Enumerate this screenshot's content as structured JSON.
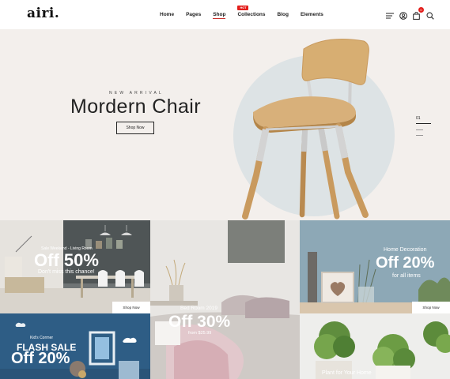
{
  "header": {
    "logo": "airi.",
    "nav": [
      {
        "label": "Home"
      },
      {
        "label": "Pages"
      },
      {
        "label": "Shop"
      },
      {
        "label": "Collections",
        "badge": "HOT"
      },
      {
        "label": "Blog"
      },
      {
        "label": "Elements"
      }
    ],
    "active_nav": "Shop",
    "cart_count": "0",
    "icons": [
      "menu-icon",
      "account-icon",
      "cart-icon",
      "search-icon"
    ]
  },
  "hero": {
    "kicker": "NEW ARRIVAL",
    "title": "Mordern Chair",
    "button": "Shop Now",
    "slide_number": "01"
  },
  "promos": {
    "living": {
      "kicker": "Sale Weekend - Living Room",
      "headline": "Off 50%",
      "subtext": "Don't miss this chance!",
      "button": "Shop Now"
    },
    "bedroom": {
      "kicker": "Bed Room 2019",
      "headline": "Off 30%",
      "subtext": "from $25.99"
    },
    "decoration": {
      "kicker": "Home Decoration",
      "headline": "Off 20%",
      "subtext": "for all items",
      "button": "Shop Now"
    },
    "kids": {
      "kicker": "Kid's Corrner",
      "headline1": "FLASH SALE",
      "headline2": "Off 20%"
    },
    "plant": {
      "kicker": "Plant for Your Home"
    }
  },
  "colors": {
    "accent": "#e31d1a",
    "hero_bg": "#f3efec",
    "circle": "#dde3e5"
  }
}
